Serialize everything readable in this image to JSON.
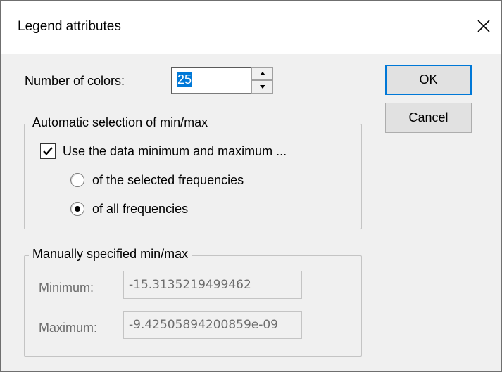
{
  "window": {
    "title": "Legend attributes"
  },
  "number_of_colors": {
    "label": "Number of colors:",
    "value": "25"
  },
  "automatic_group": {
    "title": "Automatic selection of min/max",
    "checkbox_label": "Use the data minimum and maximum ...",
    "checkbox_checked": true,
    "radio_selected_label": "of the selected frequencies",
    "radio_all_label": "of all frequencies",
    "selected_option": "of all frequencies"
  },
  "manual_group": {
    "title": "Manually specified min/max",
    "minimum_label": "Minimum:",
    "minimum_value": "-15.3135219499462",
    "maximum_label": "Maximum:",
    "maximum_value": "-9.42505894200859e-09"
  },
  "buttons": {
    "ok_label": "OK",
    "cancel_label": "Cancel"
  },
  "colors": {
    "selection_highlight": "#0078d7",
    "dialog_background": "#f0f0f0",
    "disabled_text": "#6d6d6d"
  },
  "icons": {
    "close": "close-icon",
    "spin_up": "spin-up-arrow-icon",
    "spin_down": "spin-down-arrow-icon",
    "check": "checkmark-icon"
  }
}
